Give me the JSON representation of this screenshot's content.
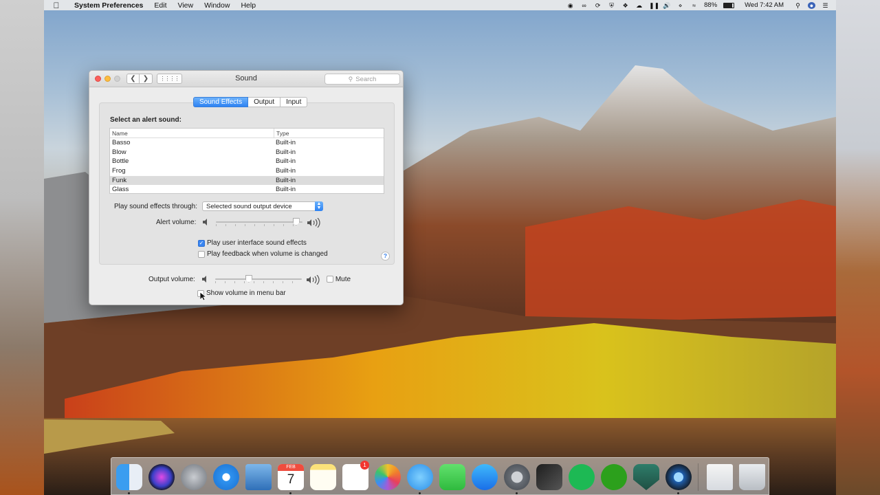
{
  "menubar": {
    "app_name": "System Preferences",
    "menus": [
      "Edit",
      "View",
      "Window",
      "Help"
    ],
    "battery": "88%",
    "clock": "Wed 7:42 AM"
  },
  "window": {
    "title": "Sound",
    "search_placeholder": "Search",
    "tabs": [
      {
        "label": "Sound Effects",
        "active": true
      },
      {
        "label": "Output",
        "active": false
      },
      {
        "label": "Input",
        "active": false
      }
    ],
    "select_label": "Select an alert sound:",
    "columns": {
      "name": "Name",
      "type": "Type"
    },
    "sounds": [
      {
        "name": "Basso",
        "type": "Built-in"
      },
      {
        "name": "Blow",
        "type": "Built-in"
      },
      {
        "name": "Bottle",
        "type": "Built-in"
      },
      {
        "name": "Frog",
        "type": "Built-in"
      },
      {
        "name": "Funk",
        "type": "Built-in",
        "selected": true
      },
      {
        "name": "Glass",
        "type": "Built-in"
      }
    ],
    "play_through_label": "Play sound effects through:",
    "play_through_value": "Selected sound output device",
    "alert_volume_label": "Alert volume:",
    "alert_volume_level": 0.96,
    "ui_sounds_label": "Play user interface sound effects",
    "ui_sounds_checked": true,
    "feedback_label": "Play feedback when volume is changed",
    "feedback_checked": false,
    "help_label": "?",
    "output_volume_label": "Output volume:",
    "output_volume_level": 0.38,
    "mute_label": "Mute",
    "mute_checked": false,
    "menu_bar_label": "Show volume in menu bar",
    "menu_bar_checked": false
  },
  "dock": {
    "calendar_month": "FEB",
    "calendar_day": "7",
    "reminders_badge": "1",
    "icons": [
      "finder-icon",
      "siri-icon",
      "launchpad-icon",
      "safari-icon",
      "mail-icon",
      "calendar-icon",
      "notes-icon",
      "reminders-icon",
      "photos-icon",
      "messages-icon",
      "facetime-icon",
      "app-store-icon",
      "system-preferences-icon",
      "final-cut-icon",
      "spotify-icon",
      "quickbooks-icon",
      "shield-app-icon",
      "quicktime-icon",
      "documents-icon",
      "trash-icon"
    ]
  },
  "colors": {
    "accent": "#2e82f3",
    "close": "#fc605c",
    "minimize": "#fdbc40"
  }
}
